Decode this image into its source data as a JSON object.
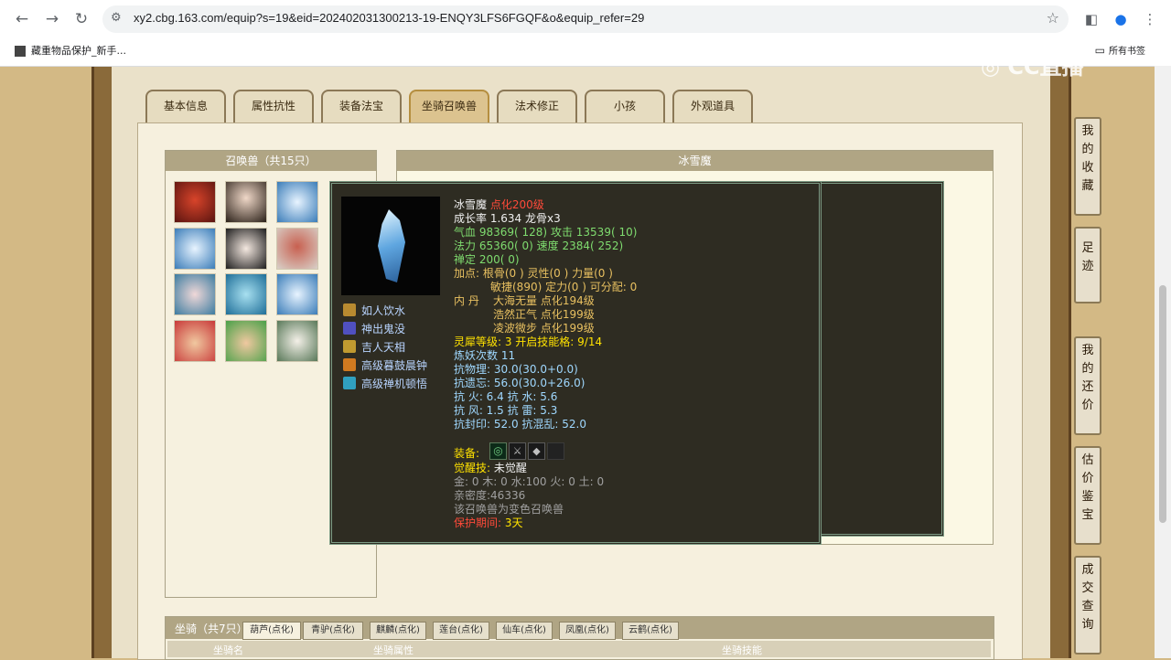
{
  "browser": {
    "url": "xy2.cbg.163.com/equip?s=19&eid=202402031300213-19-ENQY3LFS6FGQF&o&equip_refer=29",
    "bookmark_1": "藏重物品保护_新手...",
    "bookmark_all": "所有书签",
    "watermark": "CC直播"
  },
  "tabs": [
    "基本信息",
    "属性抗性",
    "装备法宝",
    "坐骑召唤兽",
    "法术修正",
    "小孩",
    "外观道具"
  ],
  "pet_list": {
    "header": "召唤兽（共15只）"
  },
  "detail": {
    "header": "冰雪魔"
  },
  "tooltip": {
    "name": "冰雪魔",
    "level": "点化200级",
    "growth": "成长率 1.634 龙骨x3",
    "hp_label": "气血",
    "hp_value": "98369( 128)",
    "atk_label": "攻击",
    "atk_value": "13539( 10)",
    "mp_label": "法力",
    "mp_value": "65360( 0)",
    "spd_label": "速度",
    "spd_value": "2384( 252)",
    "zen_label": "禅定",
    "zen_value": "200( 0)",
    "points_line1": "加点:  根骨(0 ) 灵性(0 ) 力量(0 )",
    "points_line2": "敏捷(890) 定力(0 ) 可分配:   0",
    "inner_label": "内    丹",
    "inner_1": "大海无量 点化194级",
    "inner_2": "浩然正气 点化199级",
    "inner_3": "凌波微步 点化199级",
    "lingxi_line": "灵犀等级:   3  开启技能格:   9/14",
    "lianyao": "炼妖次数 11",
    "kangwuli_label": "抗物理:",
    "kangwuli_value": "30.0(30.0+0.0)",
    "kangyiwang_label": "抗遗忘:",
    "kangyiwang_value": "56.0(30.0+26.0)",
    "kanghuo": "抗     火: 6.4 抗     水: 5.6",
    "kangfeng": "抗     风: 1.5 抗     雷: 5.3",
    "kangfengyin": "抗封印: 52.0 抗混乱: 52.0",
    "equip_label": "装备:",
    "awaken_label": "觉醒技:",
    "awaken_value": "未觉醒",
    "elements": "金: 0 木: 0 水:100 火: 0 土: 0",
    "intimacy": "亲密度:46336",
    "variant": "该召唤兽为变色召唤兽",
    "protect_label": "保护期间:",
    "protect_value": "3天",
    "skills": [
      "如人饮水",
      "神出鬼没",
      "吉人天相",
      "高级暮鼓晨钟",
      "高级禅机顿悟"
    ]
  },
  "mount": {
    "header": "坐骑（共7只）",
    "tabs": [
      "葫芦(点化)",
      "青驴(点化)",
      "麒麟(点化)",
      "莲台(点化)",
      "仙车(点化)",
      "凤凰(点化)",
      "云鹤(点化)"
    ],
    "columns": [
      "坐骑名",
      "坐骑属性",
      "坐骑技能"
    ]
  },
  "sidebar": [
    "我的收藏",
    "足迹",
    "我的还价",
    "估价鉴宝",
    "成交查询"
  ]
}
